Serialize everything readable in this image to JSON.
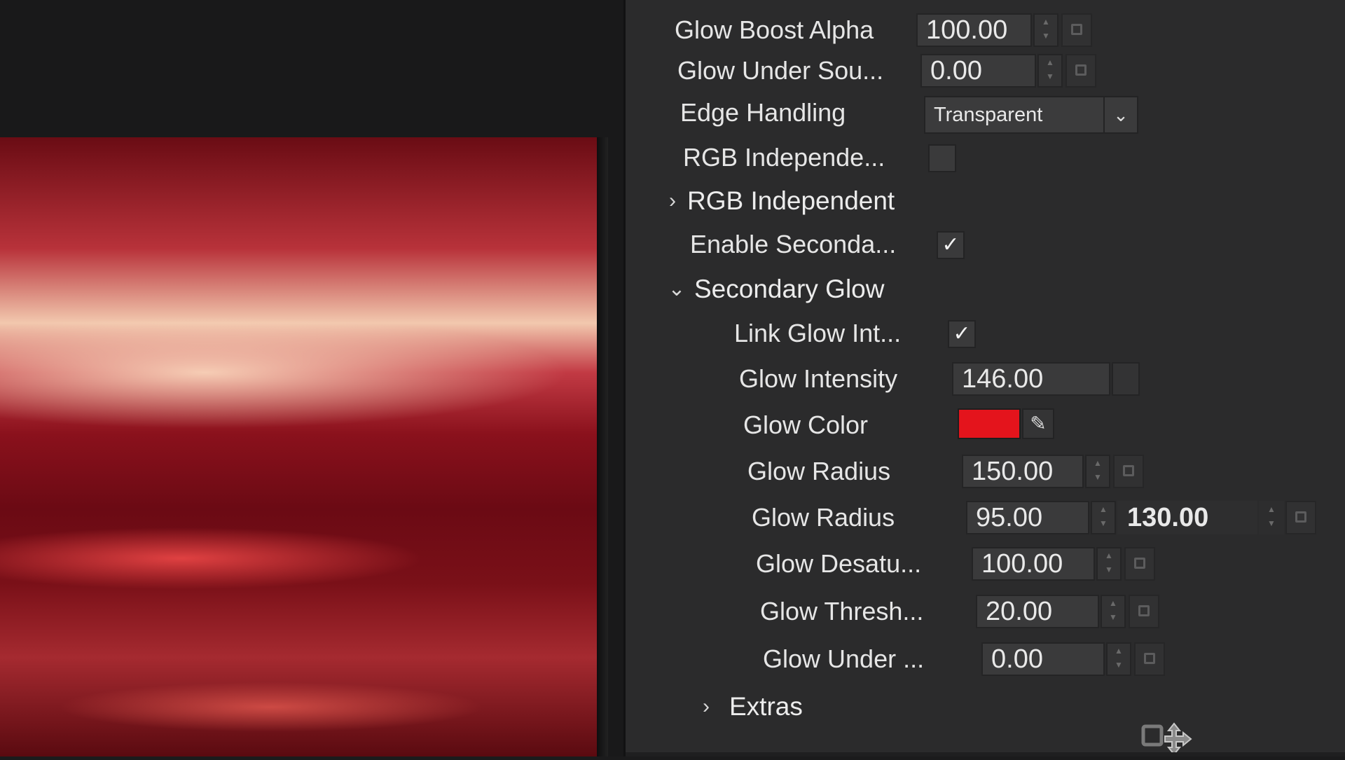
{
  "inspector": {
    "rows": [
      {
        "label": "Glow Boost Alpha",
        "value": "100.00"
      },
      {
        "label": "Glow Under Sou...",
        "value": "0.00"
      },
      {
        "label": "Edge Handling",
        "value": "Transparent"
      },
      {
        "label": "RGB Independe..."
      },
      {
        "label": "RGB Independent"
      },
      {
        "label": "Enable Seconda...",
        "check": "✓"
      },
      {
        "label": "Secondary Glow"
      },
      {
        "label": "Link Glow Int...",
        "check": "✓"
      },
      {
        "label": "Glow Intensity",
        "value": "146.00"
      },
      {
        "label": "Glow Color",
        "color": "#e4141c"
      },
      {
        "label": "Glow Radius",
        "value": "150.00"
      },
      {
        "label": "Glow Radius",
        "value": "95.00",
        "value2": "130.00"
      },
      {
        "label": "Glow Desatu...",
        "value": "100.00"
      },
      {
        "label": "Glow Thresh...",
        "value": "20.00"
      },
      {
        "label": "Glow Under ...",
        "value": "0.00"
      },
      {
        "label": "Extras"
      }
    ]
  },
  "icons": {
    "expand": "chevron-right-icon",
    "collapse": "chevron-down-icon",
    "dropdown": "chevron-down-icon",
    "picker": "eyedropper-icon",
    "keyframe": "keyframe-icon",
    "cursor": "move-cursor-icon"
  },
  "colors": {
    "panel": "#2b2b2c",
    "field": "#3a3a3b",
    "viewer": "#19191a",
    "glow_color": "#e4141c"
  }
}
